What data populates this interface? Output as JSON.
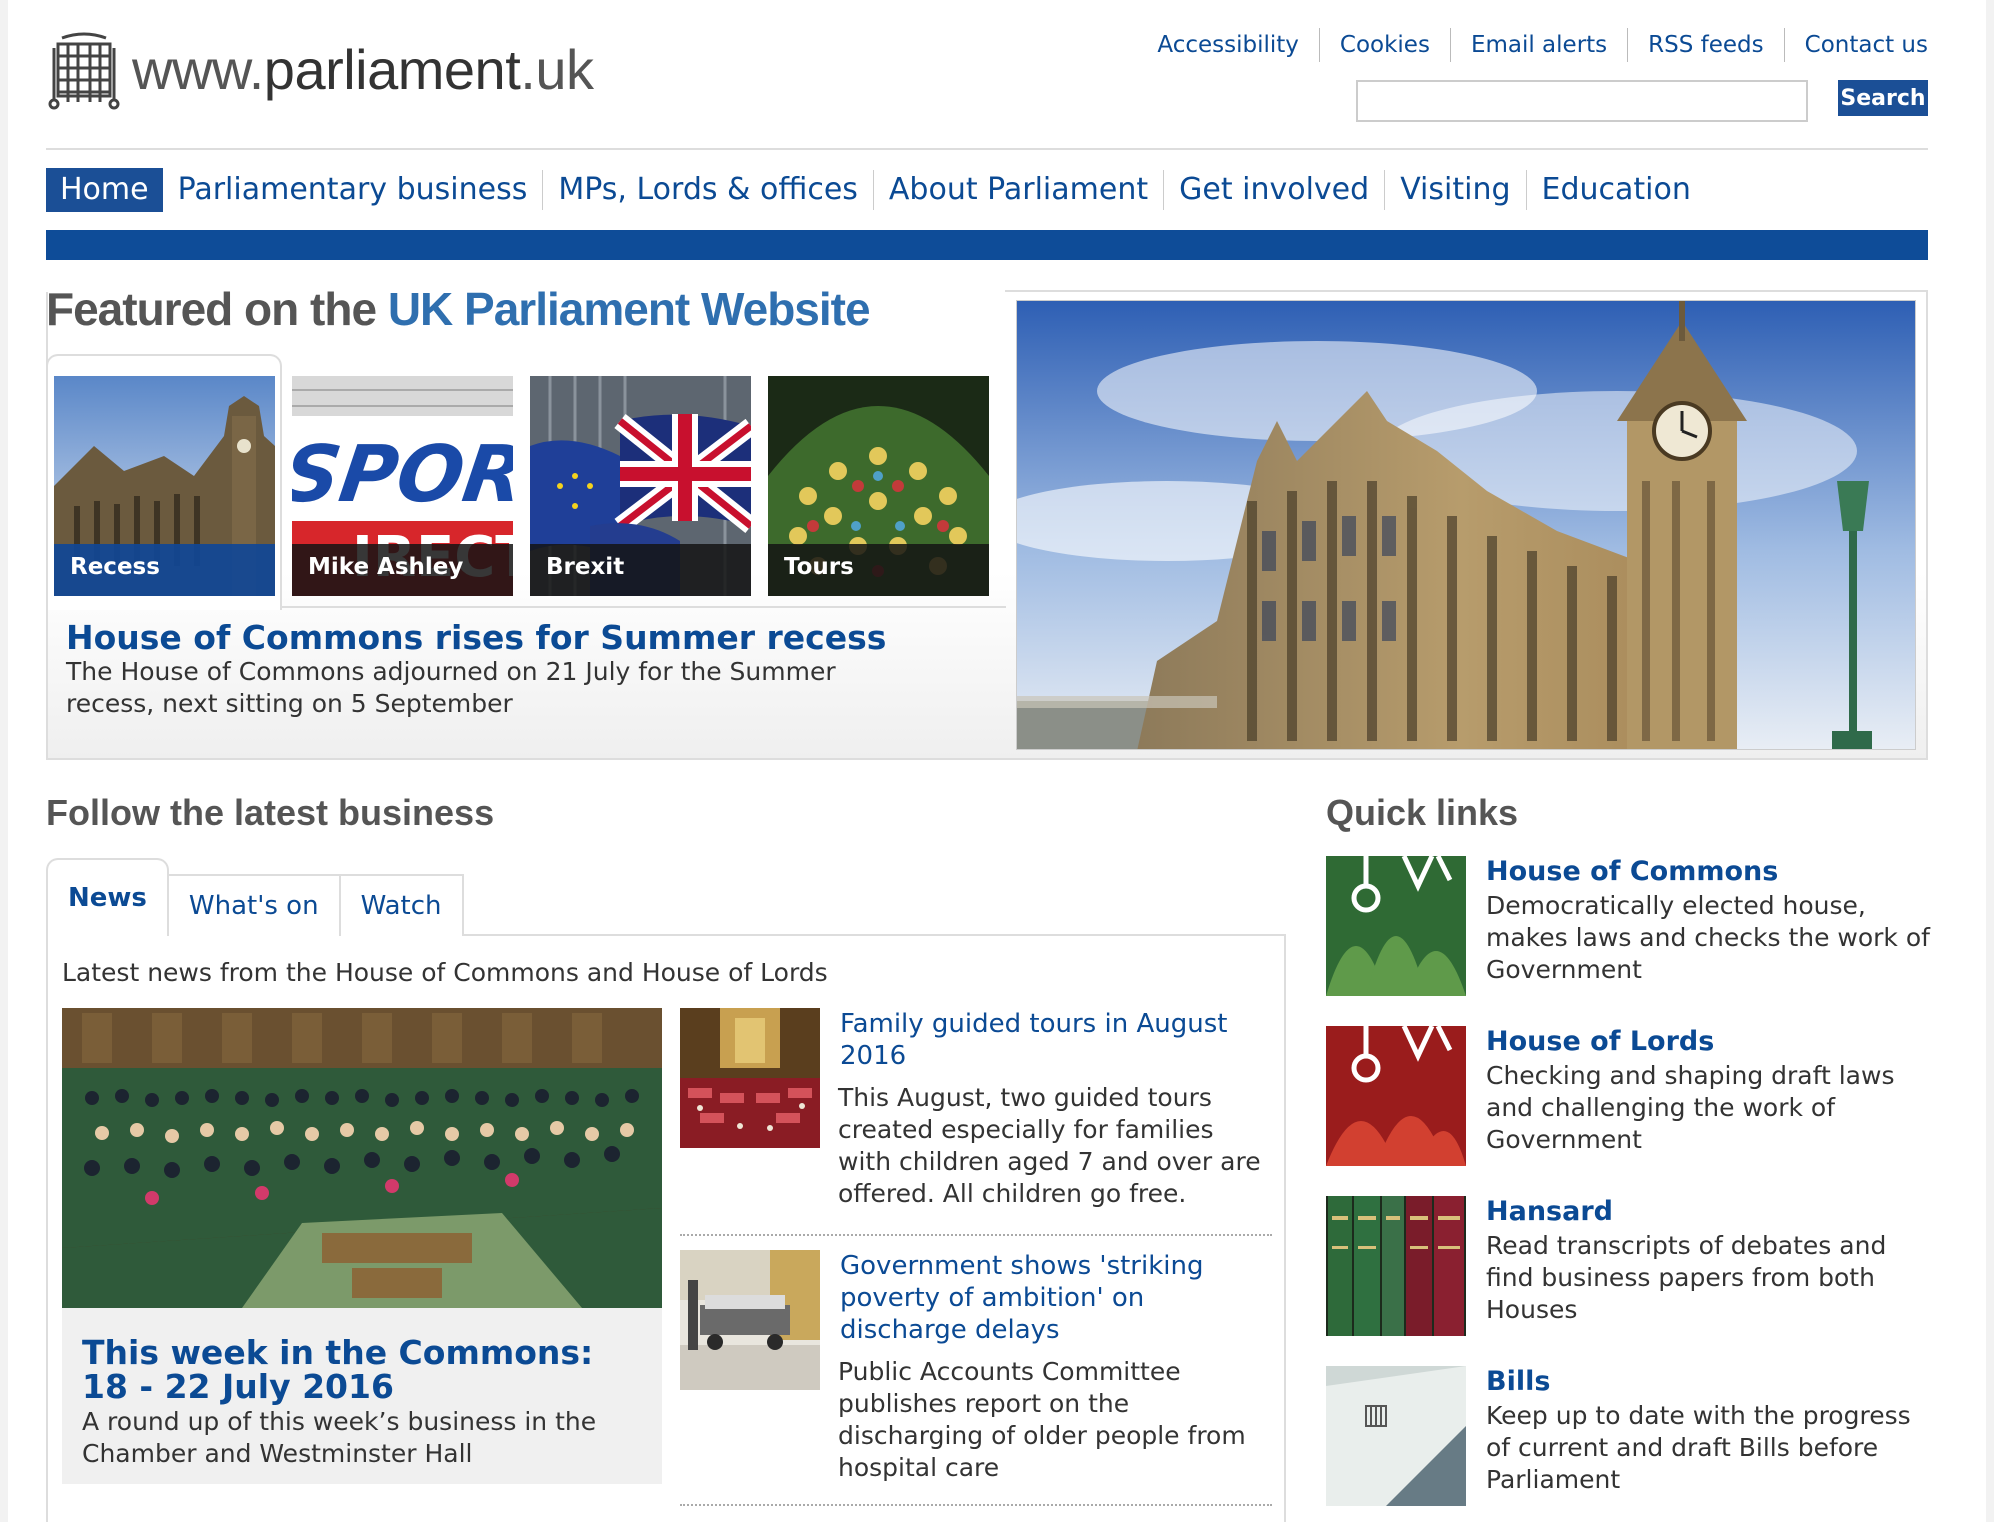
{
  "site": {
    "logo_prefix": "www.",
    "logo_main": "parliament",
    "logo_suffix": ".uk"
  },
  "utility_nav": [
    "Accessibility",
    "Cookies",
    "Email alerts",
    "RSS feeds",
    "Contact us"
  ],
  "search": {
    "button": "Search",
    "value": ""
  },
  "main_nav": [
    {
      "label": "Home",
      "active": true
    },
    {
      "label": "Parliamentary business"
    },
    {
      "label": "MPs, Lords & offices"
    },
    {
      "label": "About Parliament"
    },
    {
      "label": "Get involved"
    },
    {
      "label": "Visiting"
    },
    {
      "label": "Education"
    }
  ],
  "featured": {
    "title_lead": "Featured on the ",
    "title_accent": "UK Parliament Website",
    "thumbs": [
      "Recess",
      "Mike Ashley",
      "Brexit",
      "Tours"
    ],
    "headline": "House of Commons rises for Summer recess",
    "body": "The House of Commons adjourned on 21 July for the Summer recess, next sitting on 5 September"
  },
  "business": {
    "title": "Follow the latest business",
    "tabs": [
      "News",
      "What's on",
      "Watch"
    ],
    "intro": "Latest news from the House of Commons and House of Lords",
    "lead": {
      "title": "This week in the Commons: 18 - 22 July 2016",
      "body": "A round up of this week’s business in the Chamber and Westminster Hall"
    },
    "items": [
      {
        "title": "Family guided tours in August 2016",
        "body": "This August, two guided tours created especially for families with children aged 7 and over are offered. All children go free."
      },
      {
        "title": "Government shows 'striking poverty of ambition' on discharge delays",
        "body": "Public Accounts Committee publishes report on the discharging of older people from hospital care"
      }
    ]
  },
  "quick_links": {
    "title": "Quick links",
    "items": [
      {
        "title": "House of Commons",
        "body": "Democratically elected house, makes laws and checks the work of Government"
      },
      {
        "title": "House of Lords",
        "body": "Checking and shaping draft laws and challenging the work of Government"
      },
      {
        "title": "Hansard",
        "body": "Read transcripts of debates and find business papers from both Houses"
      },
      {
        "title": "Bills",
        "body": "Keep up to date with the progress of current and draft Bills before Parliament"
      }
    ]
  },
  "colors": {
    "brand_blue": "#0e4c98",
    "link_blue": "#0b4a94"
  }
}
